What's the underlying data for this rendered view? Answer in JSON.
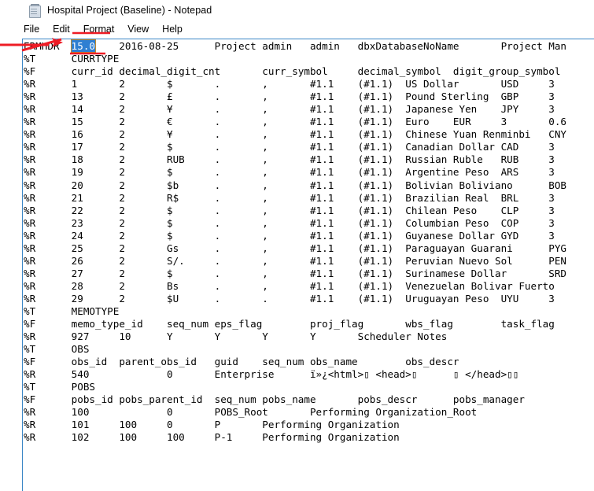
{
  "window": {
    "title": "Hospital Project (Baseline) - Notepad",
    "icon": "notepad-icon"
  },
  "menubar": {
    "items": [
      {
        "label": "File",
        "name": "menu-file",
        "underlined": false
      },
      {
        "label": "Edit",
        "name": "menu-edit",
        "underlined": false
      },
      {
        "label": "Format",
        "name": "menu-format",
        "underlined": true
      },
      {
        "label": "View",
        "name": "menu-view",
        "underlined": false
      },
      {
        "label": "Help",
        "name": "menu-help",
        "underlined": false
      }
    ]
  },
  "annotations": {
    "color": "#ee1c25",
    "arrow_target": "ERMHDR",
    "strikethrough_text": "ERMHDR",
    "underlines": [
      "Format",
      "15.0"
    ],
    "note": "red arrow points at ERMHDR record; red underlines mark Format menu and the selected version value 15.0"
  },
  "selection": {
    "text": "15.0",
    "background": "#2f7fd2",
    "foreground": "#ffffff",
    "border": "#c08a2e"
  },
  "editor": {
    "font": "monospace",
    "tab_size": 8,
    "lines": [
      {
        "id": "l01",
        "tag": "ERMHDR",
        "pre": "ERMHDR\t",
        "selected": "15.0",
        "post": "\t2016-08-25\tProject\tadmin\tadmin\tdbxDatabaseNoName\tProject Man"
      },
      {
        "id": "l02",
        "tag": "%T",
        "text": "%T\tCURRTYPE"
      },
      {
        "id": "l03",
        "tag": "%F",
        "text": "%F\tcurr_id\tdecimal_digit_cnt\tcurr_symbol\tdecimal_symbol\tdigit_group_symbol"
      },
      {
        "id": "l04",
        "tag": "%R",
        "text": "%R\t1\t2\t$\t.\t,\t#1.1\t(#1.1)\tUS Dollar\tUSD\t3"
      },
      {
        "id": "l05",
        "tag": "%R",
        "text": "%R\t13\t2\t£\t.\t,\t#1.1\t(#1.1)\tPound Sterling\tGBP\t3"
      },
      {
        "id": "l06",
        "tag": "%R",
        "text": "%R\t14\t2\t¥\t.\t,\t#1.1\t(#1.1)\tJapanese Yen\tJPY\t3"
      },
      {
        "id": "l07",
        "tag": "%R",
        "text": "%R\t15\t2\t€\t.\t,\t#1.1\t(#1.1)\tEuro\tEUR\t3\t0.6"
      },
      {
        "id": "l08",
        "tag": "%R",
        "text": "%R\t16\t2\t¥\t.\t,\t#1.1\t(#1.1)\tChinese Yuan Renminbi\tCNY"
      },
      {
        "id": "l09",
        "tag": "%R",
        "text": "%R\t17\t2\t$\t.\t,\t#1.1\t(#1.1)\tCanadian Dollar\tCAD\t3"
      },
      {
        "id": "l10",
        "tag": "%R",
        "text": "%R\t18\t2\tRUB\t.\t,\t#1.1\t(#1.1)\tRussian Ruble\tRUB\t3"
      },
      {
        "id": "l11",
        "tag": "%R",
        "text": "%R\t19\t2\t$\t.\t,\t#1.1\t(#1.1)\tArgentine Peso\tARS\t3"
      },
      {
        "id": "l12",
        "tag": "%R",
        "text": "%R\t20\t2\t$b\t.\t,\t#1.1\t(#1.1)\tBolivian Boliviano\tBOB"
      },
      {
        "id": "l13",
        "tag": "%R",
        "text": "%R\t21\t2\tR$\t.\t,\t#1.1\t(#1.1)\tBrazilian Real\tBRL\t3"
      },
      {
        "id": "l14",
        "tag": "%R",
        "text": "%R\t22\t2\t$\t.\t,\t#1.1\t(#1.1)\tChilean Peso\tCLP\t3"
      },
      {
        "id": "l15",
        "tag": "%R",
        "text": "%R\t23\t2\t$\t.\t,\t#1.1\t(#1.1)\tColumbian Peso\tCOP\t3"
      },
      {
        "id": "l16",
        "tag": "%R",
        "text": "%R\t24\t2\t$\t.\t,\t#1.1\t(#1.1)\tGuyanese Dollar\tGYD\t3"
      },
      {
        "id": "l17",
        "tag": "%R",
        "text": "%R\t25\t2\tGs\t.\t,\t#1.1\t(#1.1)\tParaguayan Guarani\tPYG"
      },
      {
        "id": "l18",
        "tag": "%R",
        "text": "%R\t26\t2\tS/.\t.\t,\t#1.1\t(#1.1)\tPeruvian Nuevo Sol\tPEN"
      },
      {
        "id": "l19",
        "tag": "%R",
        "text": "%R\t27\t2\t$\t.\t,\t#1.1\t(#1.1)\tSurinamese Dollar\tSRD"
      },
      {
        "id": "l20",
        "tag": "%R",
        "text": "%R\t28\t2\tBs\t.\t,\t#1.1\t(#1.1)\tVenezuelan Bolivar Fuerto"
      },
      {
        "id": "l21",
        "tag": "%R",
        "text": "%R\t29\t2\t$U\t.\t.\t#1.1\t(#1.1)\tUruguayan Peso\tUYU\t3"
      },
      {
        "id": "l22",
        "tag": "%T",
        "text": "%T\tMEMOTYPE"
      },
      {
        "id": "l23",
        "tag": "%F",
        "text": "%F\tmemo_type_id\tseq_num\teps_flag\tproj_flag\twbs_flag\ttask_flag"
      },
      {
        "id": "l24",
        "tag": "%R",
        "text": "%R\t927\t10\tY\tY\tY\tY\tScheduler Notes"
      },
      {
        "id": "l25",
        "tag": "%T",
        "text": "%T\tOBS"
      },
      {
        "id": "l26",
        "tag": "%F",
        "text": "%F\tobs_id\tparent_obs_id\tguid\tseq_num obs_name\tobs_descr"
      },
      {
        "id": "l27",
        "tag": "%R",
        "text": "%R\t540\t\t0\tEnterprise\tï»¿<html>▯ <head>▯\t▯ </head>▯▯"
      },
      {
        "id": "l28",
        "tag": "%T",
        "text": "%T\tPOBS"
      },
      {
        "id": "l29",
        "tag": "%F",
        "text": "%F\tpobs_id\tpobs_parent_id\tseq_num pobs_name\tpobs_descr\tpobs_manager"
      },
      {
        "id": "l30",
        "tag": "%R",
        "text": "%R\t100\t\t0\tPOBS_Root\tPerforming Organization_Root"
      },
      {
        "id": "l31",
        "tag": "%R",
        "text": "%R\t101\t100\t0\tP\tPerforming Organization"
      },
      {
        "id": "l32",
        "tag": "%R",
        "text": "%R\t102\t100\t100\tP-1\tPerforming Organization"
      }
    ]
  }
}
